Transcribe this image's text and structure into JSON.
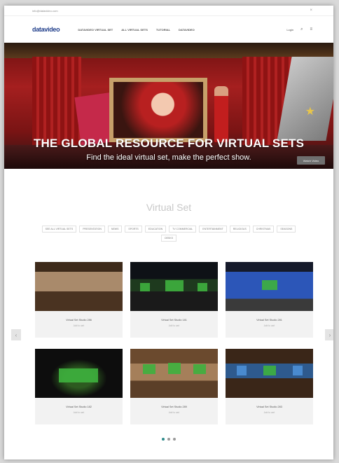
{
  "utility": {
    "left_text": "info@datavideo.com",
    "close_symbol": "×"
  },
  "header": {
    "logo": "datavideo",
    "nav": [
      "Datavideo Virtual Set",
      "All Virtual Sets",
      "Tutorial",
      "Datavideo"
    ],
    "right": {
      "label": "Login",
      "search_symbol": "⌕",
      "menu_symbol": "≡"
    }
  },
  "hero": {
    "title": "THE GLOBAL RESOURCE FOR VIRTUAL SETS",
    "subtitle": "Find the ideal virtual set, make the perfect show.",
    "button": "Watch Video"
  },
  "section": {
    "title": "Virtual Set",
    "filters": [
      "See all virtual sets",
      "Presentation",
      "News",
      "Sports",
      "Education",
      "TV Commercial",
      "Entertainment",
      "Religious",
      "Christmas",
      "Seasons",
      "Desks"
    ]
  },
  "cards": [
    {
      "title": "Virtual Set Studio 286",
      "sub": "Add to cart"
    },
    {
      "title": "Virtual Set Studio 181",
      "sub": "Add to cart"
    },
    {
      "title": "Virtual Set Studio 281",
      "sub": "Add to cart"
    },
    {
      "title": "Virtual Set Studio 182",
      "sub": "Add to cart"
    },
    {
      "title": "Virtual Set Studio 289",
      "sub": "Add to cart"
    },
    {
      "title": "Virtual Set Studio 283",
      "sub": "Add to cart"
    }
  ],
  "carousel": {
    "prev": "‹",
    "next": "›"
  }
}
